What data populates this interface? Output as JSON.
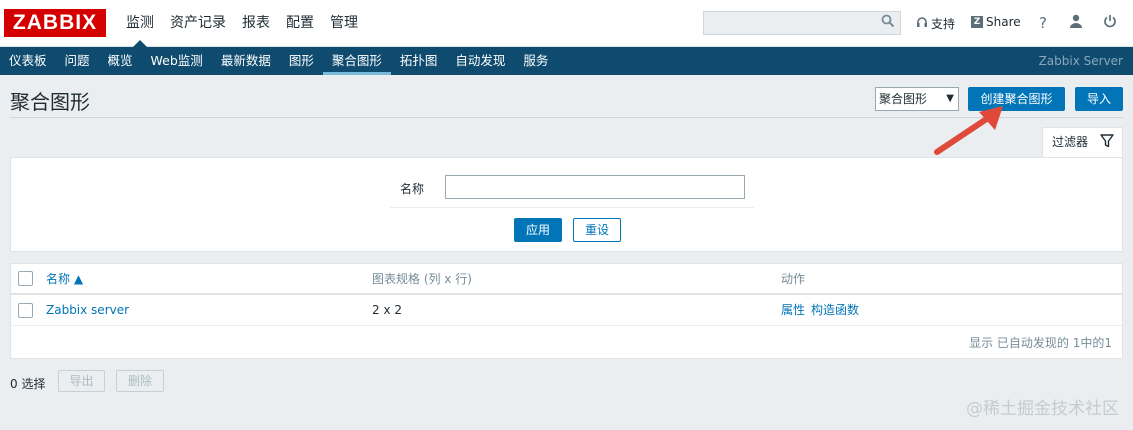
{
  "header": {
    "logo": "ZABBIX",
    "nav": [
      "监测",
      "资产记录",
      "报表",
      "配置",
      "管理"
    ],
    "nav_active": 0,
    "support_label": "支持",
    "share_label": "Share",
    "help_label": "?",
    "icons": [
      "search-icon",
      "headset-icon",
      "share-z-icon",
      "user-icon",
      "power-icon"
    ]
  },
  "subnav": {
    "items": [
      "仪表板",
      "问题",
      "概览",
      "Web监测",
      "最新数据",
      "图形",
      "聚合图形",
      "拓扑图",
      "自动发现",
      "服务"
    ],
    "active": 6,
    "server": "Zabbix Server"
  },
  "page": {
    "title": "聚合图形",
    "view_select": "聚合图形",
    "create_button": "创建聚合图形",
    "import_button": "导入"
  },
  "filter": {
    "tab_label": "过滤器",
    "name_label": "名称",
    "name_value": "",
    "apply_label": "应用",
    "reset_label": "重设"
  },
  "table": {
    "headers": {
      "name": "名称 ▲",
      "dimension": "图表规格 (列 x 行)",
      "actions": "动作"
    },
    "rows": [
      {
        "name": "Zabbix server",
        "dimension": "2 x 2",
        "action1": "属性",
        "action2": "构造函数"
      }
    ],
    "footer": "显示 已自动发现的 1中的1"
  },
  "bottom": {
    "selected": "0 选择",
    "export_label": "导出",
    "delete_label": "删除"
  },
  "watermark": "@稀土掘金技术社区",
  "colors": {
    "brand": "#d40000",
    "nav_bg": "#0e4b6e",
    "primary": "#0275b8",
    "annotation_arrow": "#e0493a"
  }
}
